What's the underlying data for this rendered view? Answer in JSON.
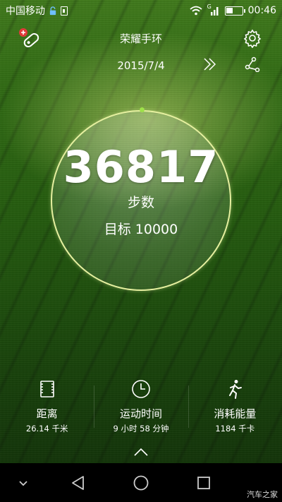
{
  "status_bar": {
    "carrier": "中国移动",
    "network_type": "G",
    "time": "00:46",
    "battery_level": 0.45
  },
  "header": {
    "title": "荣耀手环",
    "date": "2015/7/4"
  },
  "main": {
    "steps": "36817",
    "steps_label": "步数",
    "goal_label": "目标 10000",
    "goal_progress": 1.0,
    "ring_color": "#e6f0a0",
    "progress_dot_color": "#9ee24a"
  },
  "stats": [
    {
      "icon": "distance-icon",
      "label": "距离",
      "value": "26.14 千米"
    },
    {
      "icon": "clock-icon",
      "label": "运动时间",
      "value": "9 小时 58 分钟"
    },
    {
      "icon": "running-man-icon",
      "label": "消耗能量",
      "value": "1184 千卡"
    }
  ],
  "navbar": {
    "watermark": "汽车之家"
  },
  "colors": {
    "background_green": "#245d0d",
    "nav_background": "#000000",
    "alert_red": "#e03a3a"
  }
}
